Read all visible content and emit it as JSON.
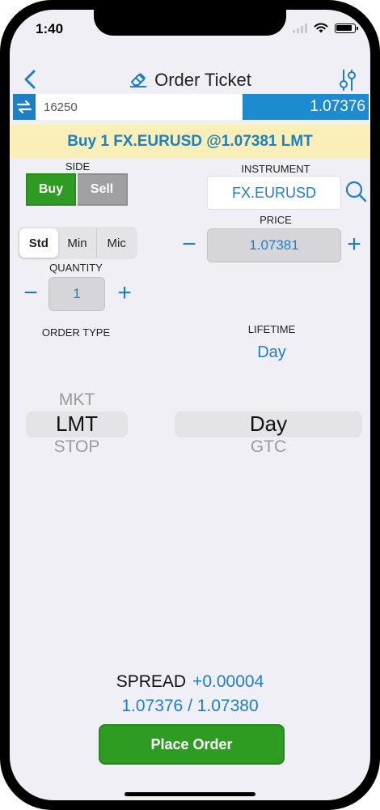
{
  "status_bar": {
    "time": "1:40"
  },
  "nav": {
    "title": "Order Ticket"
  },
  "quote_bar": {
    "quantity": "16250",
    "price": "1.07376"
  },
  "summary": {
    "text": "Buy 1 FX.EURUSD @1.07381 LMT"
  },
  "side": {
    "label": "SIDE",
    "buy": "Buy",
    "sell": "Sell",
    "selected": "Buy"
  },
  "instrument": {
    "label": "INSTRUMENT",
    "value": "FX.EURUSD"
  },
  "size_type": {
    "options": [
      "Std",
      "Min",
      "Mic"
    ],
    "selected": "Std"
  },
  "price": {
    "label": "PRICE",
    "value": "1.07381"
  },
  "quantity": {
    "label": "QUANTITY",
    "value": "1"
  },
  "order_type": {
    "label": "ORDER TYPE",
    "options": [
      "MKT",
      "LMT",
      "STOP"
    ],
    "selected": "LMT"
  },
  "lifetime": {
    "label": "LIFETIME",
    "value": "Day",
    "options": [
      "Day",
      "GTC"
    ],
    "selected": "Day"
  },
  "spread": {
    "label": "SPREAD",
    "value": "+0.00004",
    "bid_ask": "1.07376 / 1.07380"
  },
  "place_order": {
    "label": "Place Order"
  },
  "colors": {
    "accent": "#1d7fc4",
    "buy": "#2e9b22",
    "sell": "#a0a0a4",
    "summary_bg": "#faefb8"
  }
}
